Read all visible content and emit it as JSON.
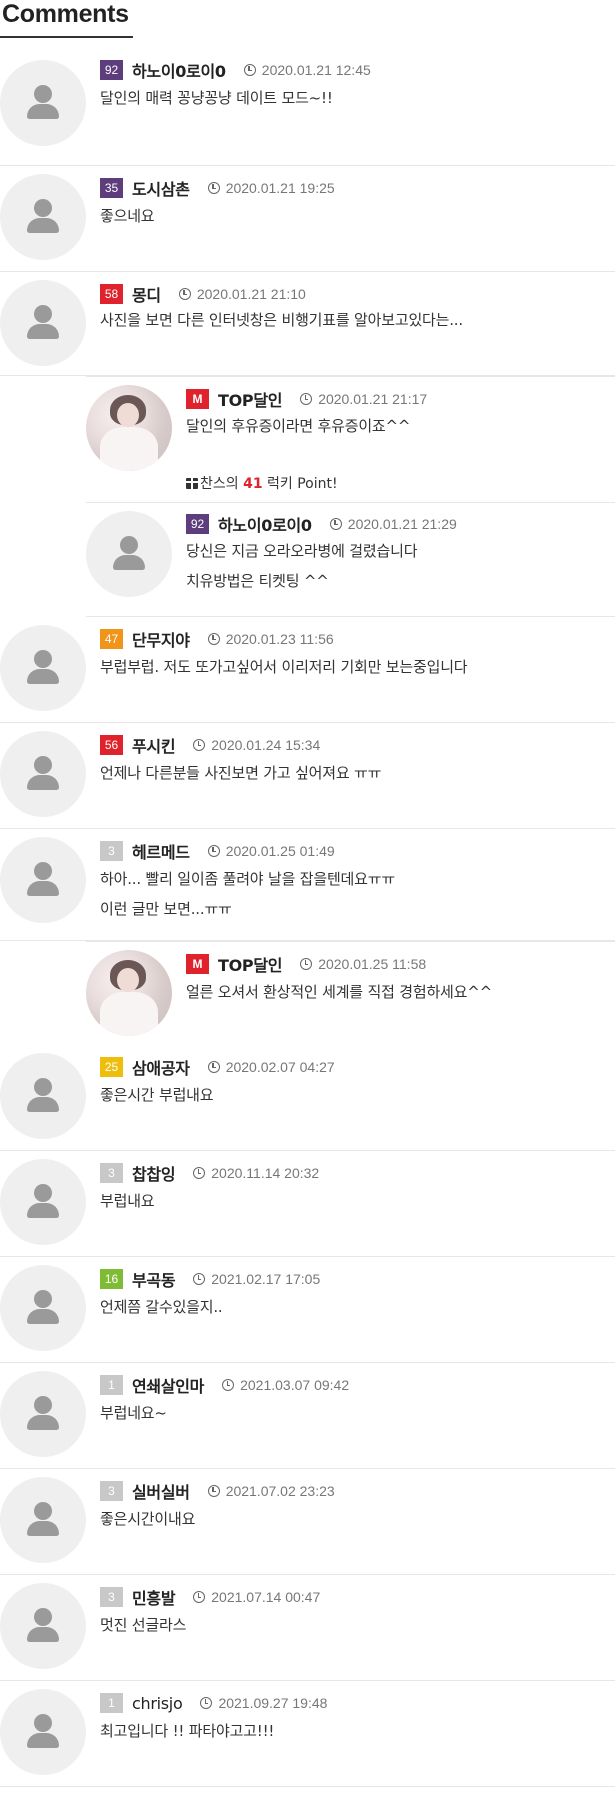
{
  "title": "Comments",
  "comments": [
    {
      "id": "c1",
      "level": "92",
      "level_color": "#5e3d7d",
      "nick": "하노이0로이0",
      "date": "2020.01.21 12:45",
      "lines": [
        "달인의 매력 꽁냥꽁냥 데이트 모드~!!"
      ]
    },
    {
      "id": "c2",
      "level": "35",
      "level_color": "#5e3d7d",
      "nick": "도시삼촌",
      "date": "2020.01.21 19:25",
      "lines": [
        "좋으네요"
      ]
    },
    {
      "id": "c3",
      "level": "58",
      "level_color": "#e0222c",
      "nick": "몽디",
      "date": "2020.01.21 21:10",
      "lines": [
        "사진을 보면 다른 인터넷창은 비행기표를 알아보고있다는..."
      ]
    },
    {
      "id": "c3r1",
      "reply": true,
      "admin": true,
      "level": "M",
      "level_color": "#e0222c",
      "nick": "TOP달인",
      "date": "2020.01.21 21:17",
      "lines": [
        "달인의 후유증이라면 후유증이죠^^"
      ],
      "extra": {
        "prefix": "찬스의",
        "number": "41",
        "suffix": "럭키 Point!"
      }
    },
    {
      "id": "c3r2",
      "reply": true,
      "level": "92",
      "level_color": "#5e3d7d",
      "nick": "하노이0로이0",
      "date": "2020.01.21 21:29",
      "lines": [
        "당신은 지금 오라오라병에 걸렸습니다",
        "치유방법은 티켓팅 ^^"
      ]
    },
    {
      "id": "c4",
      "level": "47",
      "level_color": "#f0941a",
      "nick": "단무지야",
      "date": "2020.01.23 11:56",
      "lines": [
        "부럽부럽. 저도 또가고싶어서 이리저리 기회만 보는중입니다"
      ]
    },
    {
      "id": "c5",
      "level": "56",
      "level_color": "#e0222c",
      "nick": "푸시킨",
      "date": "2020.01.24 15:34",
      "lines": [
        "언제나 다른분들 사진보면 가고 싶어져요 ㅠㅠ"
      ]
    },
    {
      "id": "c6",
      "level": "3",
      "level_color": "#c8c8c8",
      "nick": "헤르메드",
      "date": "2020.01.25 01:49",
      "lines": [
        "하아... 빨리 일이좀 풀려야 날을 잡을텐데요ㅠㅠ",
        "이런 글만 보면...ㅠㅠ"
      ]
    },
    {
      "id": "c6r1",
      "reply": true,
      "admin": true,
      "level": "M",
      "level_color": "#e0222c",
      "nick": "TOP달인",
      "date": "2020.01.25 11:58",
      "lines": [
        "얼른 오셔서 환상적인 세계를 직접 경험하세요^^"
      ]
    },
    {
      "id": "c7",
      "level": "25",
      "level_color": "#efbd0c",
      "nick": "삼애공자",
      "date": "2020.02.07 04:27",
      "lines": [
        "좋은시간 부럽내요"
      ]
    },
    {
      "id": "c8",
      "level": "3",
      "level_color": "#c8c8c8",
      "nick": "찹찹잉",
      "date": "2020.11.14 20:32",
      "lines": [
        "부럽내요"
      ]
    },
    {
      "id": "c9",
      "level": "16",
      "level_color": "#7fbb34",
      "nick": "부곡동",
      "date": "2021.02.17 17:05",
      "lines": [
        "언제쯤 갈수있을지.."
      ]
    },
    {
      "id": "c10",
      "level": "1",
      "level_color": "#c8c8c8",
      "nick": "연쇄살인마",
      "date": "2021.03.07 09:42",
      "lines": [
        "부럽네요~"
      ]
    },
    {
      "id": "c11",
      "level": "3",
      "level_color": "#c8c8c8",
      "nick": "실버실버",
      "date": "2021.07.02 23:23",
      "lines": [
        "좋은시간이내요"
      ]
    },
    {
      "id": "c12",
      "level": "3",
      "level_color": "#c8c8c8",
      "nick": "민흥발",
      "date": "2021.07.14 00:47",
      "lines": [
        "멋진 선글라스"
      ]
    },
    {
      "id": "c13",
      "level": "1",
      "level_color": "#c8c8c8",
      "nick": "chrisjo",
      "date": "2021.09.27 19:48",
      "lines": [
        "최고입니다 !! 파타야고고!!!"
      ]
    }
  ]
}
